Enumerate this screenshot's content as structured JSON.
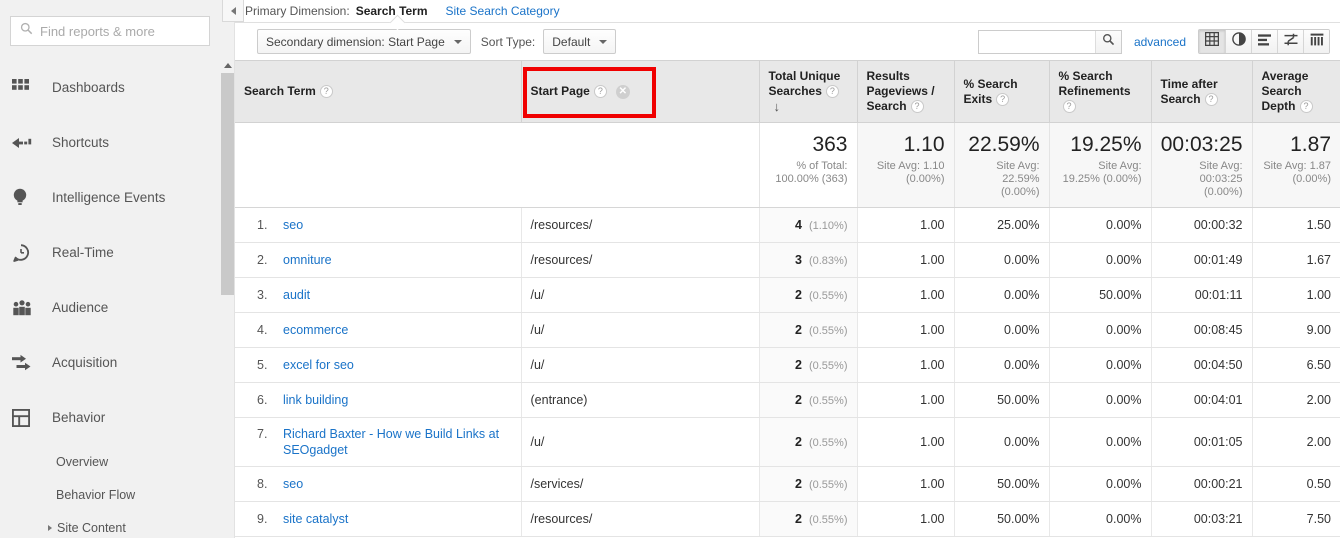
{
  "sidebar": {
    "search": {
      "placeholder": "Find reports & more",
      "value": "",
      "icon": "search-icon"
    },
    "items": [
      {
        "label": "Dashboards",
        "icon": "grid-icon"
      },
      {
        "label": "Shortcuts",
        "icon": "arrow-left-dashed-icon"
      },
      {
        "label": "Intelligence Events",
        "icon": "lightbulb-icon"
      },
      {
        "label": "Real-Time",
        "icon": "clock-speech-icon"
      },
      {
        "label": "Audience",
        "icon": "people-icon"
      },
      {
        "label": "Acquisition",
        "icon": "arrows-right-icon"
      },
      {
        "label": "Behavior",
        "icon": "layout-icon"
      }
    ],
    "subitems": [
      {
        "label": "Overview",
        "caret": false
      },
      {
        "label": "Behavior Flow",
        "caret": false
      },
      {
        "label": "Site Content",
        "caret": true
      }
    ]
  },
  "rail": {
    "collapse_icon": "collapse-left-icon",
    "scroll_up_icon": "chevron-up-icon"
  },
  "primary_dimension": {
    "label": "Primary Dimension:",
    "selected": "Search Term",
    "alternate": "Site Search Category"
  },
  "controls": {
    "secondary_dimension": "Secondary dimension: Start Page",
    "sort_type_label": "Sort Type:",
    "sort_type_value": "Default",
    "search": {
      "value": "",
      "placeholder": ""
    },
    "advanced": "advanced",
    "views": [
      {
        "name": "table-view",
        "icon": "table-icon",
        "active": true
      },
      {
        "name": "percentage-view",
        "icon": "pie-icon",
        "active": false
      },
      {
        "name": "performance-view",
        "icon": "bars-icon",
        "active": false
      },
      {
        "name": "comparison-view",
        "icon": "comparison-icon",
        "active": false
      },
      {
        "name": "pivot-view",
        "icon": "pivot-icon",
        "active": false
      }
    ]
  },
  "annotation": {
    "color": "#f00000",
    "target": "Start Page"
  },
  "chart_data": {
    "type": "table",
    "title": "Site Search Terms",
    "columns": [
      {
        "label": "Search Term",
        "help": true,
        "sorted": false
      },
      {
        "label": "Start Page",
        "help": true,
        "removable": true,
        "sorted": false
      },
      {
        "label": "Total Unique Searches",
        "help": true,
        "sorted": true,
        "sort_dir": "desc"
      },
      {
        "label": "Results Pageviews / Search",
        "help": true,
        "sorted": false
      },
      {
        "label": "% Search Exits",
        "help": true,
        "sorted": false
      },
      {
        "label": "% Search Refinements",
        "help": true,
        "sorted": false
      },
      {
        "label": "Time after Search",
        "help": true,
        "sorted": false
      },
      {
        "label": "Average Search Depth",
        "help": true,
        "sorted": false
      }
    ],
    "summary": [
      {
        "value": "363",
        "sub": "% of Total: 100.00% (363)"
      },
      {
        "value": "1.10",
        "sub": "Site Avg: 1.10 (0.00%)"
      },
      {
        "value": "22.59%",
        "sub": "Site Avg: 22.59% (0.00%)"
      },
      {
        "value": "19.25%",
        "sub": "Site Avg: 19.25% (0.00%)"
      },
      {
        "value": "00:03:25",
        "sub": "Site Avg: 00:03:25 (0.00%)"
      },
      {
        "value": "1.87",
        "sub": "Site Avg: 1.87 (0.00%)"
      }
    ],
    "rows": [
      {
        "index": "1.",
        "search_term": "seo",
        "start_page": "/resources/",
        "unique": "4",
        "unique_pct": "(1.10%)",
        "results_pv": "1.00",
        "exits": "25.00%",
        "refinements": "0.00%",
        "time_after": "00:00:32",
        "depth": "1.50"
      },
      {
        "index": "2.",
        "search_term": "omniture",
        "start_page": "/resources/",
        "unique": "3",
        "unique_pct": "(0.83%)",
        "results_pv": "1.00",
        "exits": "0.00%",
        "refinements": "0.00%",
        "time_after": "00:01:49",
        "depth": "1.67"
      },
      {
        "index": "3.",
        "search_term": "audit",
        "start_page": "/u/",
        "unique": "2",
        "unique_pct": "(0.55%)",
        "results_pv": "1.00",
        "exits": "0.00%",
        "refinements": "50.00%",
        "time_after": "00:01:11",
        "depth": "1.00"
      },
      {
        "index": "4.",
        "search_term": "ecommerce",
        "start_page": "/u/",
        "unique": "2",
        "unique_pct": "(0.55%)",
        "results_pv": "1.00",
        "exits": "0.00%",
        "refinements": "0.00%",
        "time_after": "00:08:45",
        "depth": "9.00"
      },
      {
        "index": "5.",
        "search_term": "excel for seo",
        "start_page": "/u/",
        "unique": "2",
        "unique_pct": "(0.55%)",
        "results_pv": "1.00",
        "exits": "0.00%",
        "refinements": "0.00%",
        "time_after": "00:04:50",
        "depth": "6.50"
      },
      {
        "index": "6.",
        "search_term": "link building",
        "start_page": "(entrance)",
        "unique": "2",
        "unique_pct": "(0.55%)",
        "results_pv": "1.00",
        "exits": "50.00%",
        "refinements": "0.00%",
        "time_after": "00:04:01",
        "depth": "2.00"
      },
      {
        "index": "7.",
        "search_term": "Richard Baxter - How we Build Links at SEOgadget",
        "start_page": "/u/",
        "unique": "2",
        "unique_pct": "(0.55%)",
        "results_pv": "1.00",
        "exits": "0.00%",
        "refinements": "0.00%",
        "time_after": "00:01:05",
        "depth": "2.00"
      },
      {
        "index": "8.",
        "search_term": "seo",
        "start_page": "/services/",
        "unique": "2",
        "unique_pct": "(0.55%)",
        "results_pv": "1.00",
        "exits": "50.00%",
        "refinements": "0.00%",
        "time_after": "00:00:21",
        "depth": "0.50"
      },
      {
        "index": "9.",
        "search_term": "site catalyst",
        "start_page": "/resources/",
        "unique": "2",
        "unique_pct": "(0.55%)",
        "results_pv": "1.00",
        "exits": "50.00%",
        "refinements": "0.00%",
        "time_after": "00:03:21",
        "depth": "7.50"
      }
    ]
  }
}
